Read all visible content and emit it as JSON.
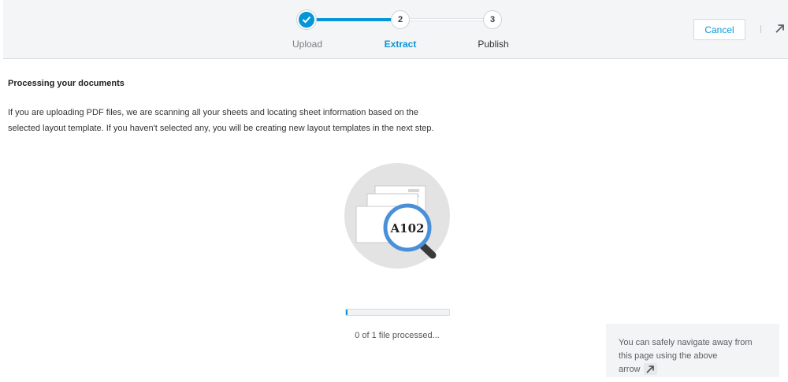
{
  "wizard": {
    "steps": [
      {
        "number": "",
        "label": "Upload",
        "state": "completed"
      },
      {
        "number": "2",
        "label": "Extract",
        "state": "active"
      },
      {
        "number": "3",
        "label": "Publish",
        "state": "pending"
      }
    ],
    "cancel_label": "Cancel",
    "open_icon": "arrow-up-right-icon"
  },
  "main": {
    "title": "Processing your documents",
    "description_line1": "If you are uploading PDF files, we are scanning all your sheets and locating sheet information based on the",
    "description_line2": "selected layout template. If you haven't selected any, you will be creating new layout templates in the next step.",
    "illustration": {
      "icon": "magnifier-sheets-icon",
      "sheet_label": "A102"
    },
    "progress": {
      "fraction": 0.0,
      "text": "0 of 1 file processed..."
    }
  },
  "hint": {
    "line1": "You can safely navigate away from",
    "line2": "this page using the above",
    "line3": "arrow",
    "icon": "arrow-up-right-icon"
  },
  "colors": {
    "accent": "#0696d7",
    "header_bg": "#f4f5f6",
    "hint_bg": "#f3f4f5"
  }
}
